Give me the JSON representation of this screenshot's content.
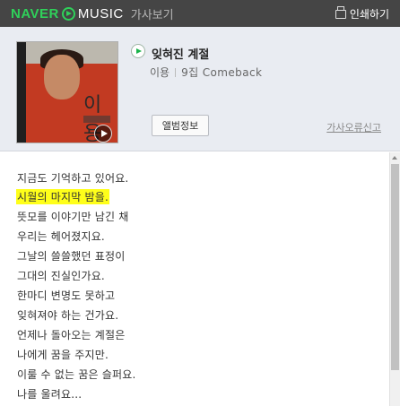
{
  "header": {
    "brand_naver": "NAVER",
    "brand_music": "MUSIC",
    "brand_sub": "가사보기",
    "print_label": "인쇄하기",
    "print_icon": "printer-icon"
  },
  "album": {
    "cover_title": "이용",
    "cover_icon": "album-cover-image"
  },
  "track": {
    "title": "잊혀진 계절",
    "artist": "이용",
    "album": "9집 Comeback",
    "play_icon": "play-icon"
  },
  "actions": {
    "album_info": "앨범정보",
    "report": "가사오류신고"
  },
  "lyrics": {
    "lines": [
      "지금도 기억하고 있어요.",
      "시월의 마지막 밤을.",
      "뜻모를 이야기만 남긴 채",
      "우리는 헤어졌지요.",
      "그날의 쓸쓸했던 표정이",
      "그대의 진실인가요.",
      "한마디 변명도 못하고",
      "잊혀져야 하는 건가요.",
      "언제나 돌아오는 계절은",
      "나에게 꿈을 주지만.",
      "이룰 수 없는 꿈은 슬퍼요.",
      "나를 울려요..."
    ],
    "highlighted_index": 1,
    "highlight_color": "#ffff1a"
  },
  "colors": {
    "topbar": "#454545",
    "brand_green": "#2fd15a",
    "info_bg": "#e9ecf2"
  }
}
